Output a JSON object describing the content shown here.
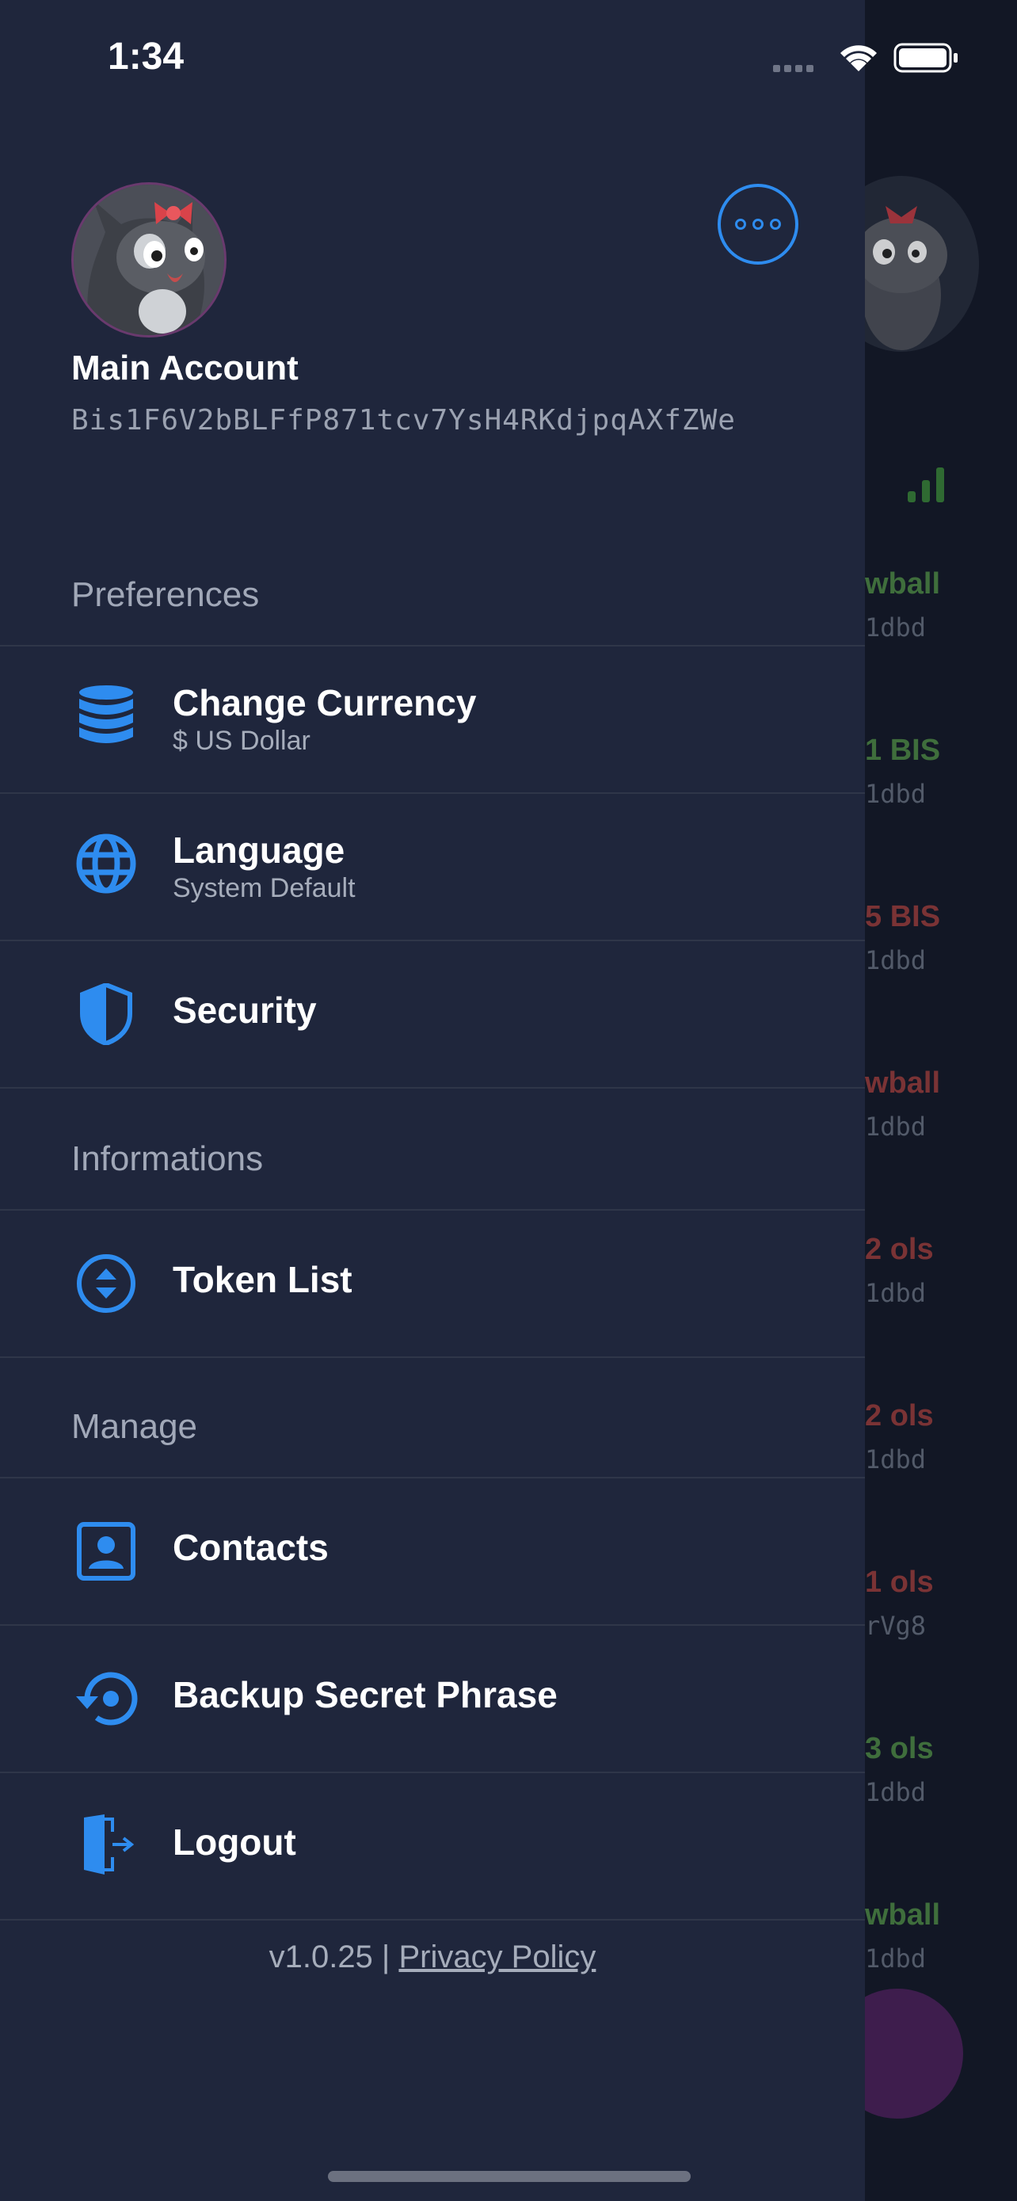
{
  "status_bar": {
    "time": "1:34"
  },
  "account": {
    "name": "Main Account",
    "address": "Bis1F6V2bBLFfP871tcv7YsH4RKdjpqAXfZWe"
  },
  "sections": {
    "preferences": "Preferences",
    "informations": "Informations",
    "manage": "Manage"
  },
  "menu": {
    "change_currency": {
      "label": "Change Currency",
      "sub": "$ US Dollar",
      "icon": "database-icon"
    },
    "language": {
      "label": "Language",
      "sub": "System Default",
      "icon": "globe-icon"
    },
    "security": {
      "label": "Security",
      "icon": "shield-icon"
    },
    "token_list": {
      "label": "Token List",
      "icon": "sort-arrows-icon"
    },
    "contacts": {
      "label": "Contacts",
      "icon": "contact-card-icon"
    },
    "backup": {
      "label": "Backup Secret Phrase",
      "icon": "restore-icon"
    },
    "logout": {
      "label": "Logout",
      "icon": "door-exit-icon"
    }
  },
  "footer": {
    "version": "v1.0.25 |",
    "privacy_link": "Privacy Policy"
  },
  "background_list": [
    {
      "amount": "wball",
      "sub": "1dbd",
      "color": "#3f6e3c"
    },
    {
      "amount": "1 BIS",
      "sub": "1dbd",
      "color": "#3f6e3c"
    },
    {
      "amount": "5 BIS",
      "sub": "1dbd",
      "color": "#7a3335"
    },
    {
      "amount": "wball",
      "sub": "1dbd",
      "color": "#7a3335"
    },
    {
      "amount": "2 ols",
      "sub": "1dbd",
      "color": "#7a3335"
    },
    {
      "amount": "2 ols",
      "sub": "1dbd",
      "color": "#7a3335"
    },
    {
      "amount": "1 ols",
      "sub": "rVg8",
      "color": "#7a3335"
    },
    {
      "amount": "3 ols",
      "sub": "1dbd",
      "color": "#3f6e3c"
    },
    {
      "amount": "wball",
      "sub": "1dbd",
      "color": "#3f6e3c"
    }
  ],
  "colors": {
    "accent": "#2e8cef",
    "drawer_bg": "#1f263c",
    "positive": "#3f6e3c",
    "negative": "#7a3335"
  }
}
